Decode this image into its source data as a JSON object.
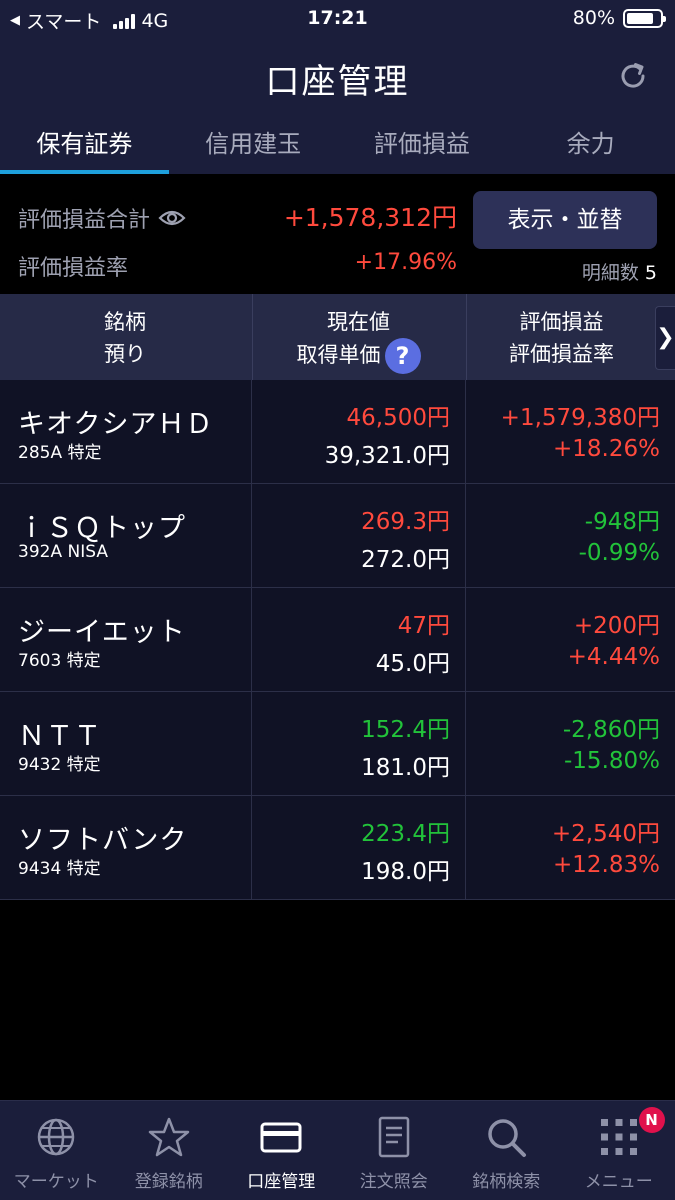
{
  "status_bar": {
    "carrier": "スマート",
    "network": "4G",
    "time": "17:21",
    "battery": "80%",
    "battery_level": 0.8
  },
  "header": {
    "title": "口座管理"
  },
  "tabs": [
    {
      "label": "保有証券",
      "active": true
    },
    {
      "label": "信用建玉",
      "active": false
    },
    {
      "label": "評価損益",
      "active": false
    },
    {
      "label": "余力",
      "active": false
    }
  ],
  "summary": {
    "total_label": "評価損益合計",
    "total_value": "+1,578,312円",
    "rate_label": "評価損益率",
    "rate_value": "+17.96%",
    "display_button": "表示・並替",
    "detail_label": "明細数",
    "detail_count": "5"
  },
  "table_header": {
    "col1_line1": "銘柄",
    "col1_line2": "預り",
    "col2_line1": "現在値",
    "col2_line2": "取得単価",
    "help": "?",
    "col3_line1": "評価損益",
    "col3_line2": "評価損益率",
    "scroll_arrow": "❯"
  },
  "holdings": [
    {
      "name": "キオクシアＨＤ",
      "sub": "285A 特定",
      "price": "46,500円",
      "price_color": "red",
      "cost": "39,321.0円",
      "pl": "+1,579,380円",
      "pl_rate": "+18.26%",
      "pl_color": "red"
    },
    {
      "name": "ｉＳＱトップ",
      "sub": "392A NISA",
      "price": "269.3円",
      "price_color": "red",
      "cost": "272.0円",
      "pl": "-948円",
      "pl_rate": "-0.99%",
      "pl_color": "green"
    },
    {
      "name": "ジーイエット",
      "sub": "7603 特定",
      "price": "47円",
      "price_color": "red",
      "cost": "45.0円",
      "pl": "+200円",
      "pl_rate": "+4.44%",
      "pl_color": "red"
    },
    {
      "name": "ＮＴＴ",
      "sub": "9432 特定",
      "price": "152.4円",
      "price_color": "green",
      "cost": "181.0円",
      "pl": "-2,860円",
      "pl_rate": "-15.80%",
      "pl_color": "green"
    },
    {
      "name": "ソフトバンク",
      "sub": "9434 特定",
      "price": "223.4円",
      "price_color": "green",
      "cost": "198.0円",
      "pl": "+2,540円",
      "pl_rate": "+12.83%",
      "pl_color": "red"
    }
  ],
  "bottom_nav": [
    {
      "label": "マーケット",
      "icon": "globe-icon",
      "active": false
    },
    {
      "label": "登録銘柄",
      "icon": "star-icon",
      "active": false
    },
    {
      "label": "口座管理",
      "icon": "card-icon",
      "active": true
    },
    {
      "label": "注文照会",
      "icon": "document-icon",
      "active": false
    },
    {
      "label": "銘柄検索",
      "icon": "search-icon",
      "active": false
    },
    {
      "label": "メニュー",
      "icon": "grid-menu-icon",
      "active": false,
      "badge": "N"
    }
  ],
  "colors": {
    "background": "#000000",
    "header": "#1b1e3b",
    "accent": "#1ea0dc",
    "positive": "#ff4a3d",
    "negative": "#22c33a"
  }
}
